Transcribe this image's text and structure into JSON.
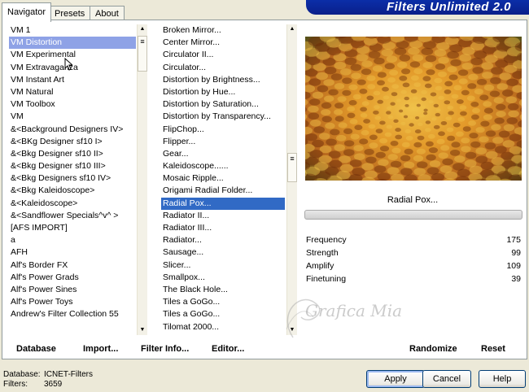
{
  "tabs": {
    "navigator": "Navigator",
    "presets": "Presets",
    "about": "About"
  },
  "banner": {
    "title": "Filters Unlimited 2.0"
  },
  "categories": [
    "VM 1",
    "VM Distortion",
    "VM Experimental",
    "VM Extravaganza",
    "VM Instant Art",
    "VM Natural",
    "VM Toolbox",
    "VM",
    "&<Background Designers IV>",
    "&<BKg Designer sf10 I>",
    "&<Bkg Designer sf10 II>",
    "&<Bkg Designer sf10 III>",
    "&<Bkg Designers sf10 IV>",
    "&<Bkg Kaleidoscope>",
    "&<Kaleidoscope>",
    "&<Sandflower Specials^v^ >",
    "[AFS IMPORT]",
    "a",
    "AFH",
    "Alf's Border FX",
    "Alf's Power Grads",
    "Alf's Power Sines",
    "Alf's Power Toys",
    "Andrew's Filter Collection 55"
  ],
  "categories_selected": "VM Distortion",
  "filters": [
    "Broken Mirror...",
    "Center Mirror...",
    "Circulator II...",
    "Circulator...",
    "Distortion by Brightness...",
    "Distortion by Hue...",
    "Distortion by Saturation...",
    "Distortion by Transparency...",
    "FlipChop...",
    "Flipper...",
    "Gear...",
    "Kaleidoscope......",
    "Mosaic Ripple...",
    "Origami Radial Folder...",
    "Radial Pox...",
    "Radiator II...",
    "Radiator III...",
    "Radiator...",
    "Sausage...",
    "Slicer...",
    "Smallpox...",
    "The Black Hole...",
    "Tiles a GoGo...",
    "Tiles a GoGo...",
    "Tilomat 2000..."
  ],
  "filters_selected": "Radial Pox...",
  "preview": {
    "filter_name": "Radial Pox...",
    "colors": [
      "#6b2a08",
      "#b5651d",
      "#e39a2a",
      "#f0c24a",
      "#3a4a18"
    ]
  },
  "sliders": [
    {
      "label": "Frequency",
      "value": "175"
    },
    {
      "label": "Strength",
      "value": "99"
    },
    {
      "label": "Amplify",
      "value": "109"
    },
    {
      "label": "Finetuning",
      "value": "39"
    }
  ],
  "bottom_bar": {
    "database": "Database",
    "import": "Import...",
    "filter_info": "Filter Info...",
    "editor": "Editor...",
    "randomize": "Randomize",
    "reset": "Reset"
  },
  "status": {
    "database_label": "Database:",
    "database_value": "ICNET-Filters",
    "filters_label": "Filters:",
    "filters_value": "3659"
  },
  "buttons": {
    "apply": "Apply",
    "cancel": "Cancel",
    "help": "Help"
  },
  "watermark": {
    "text": "Grafica Mia"
  }
}
